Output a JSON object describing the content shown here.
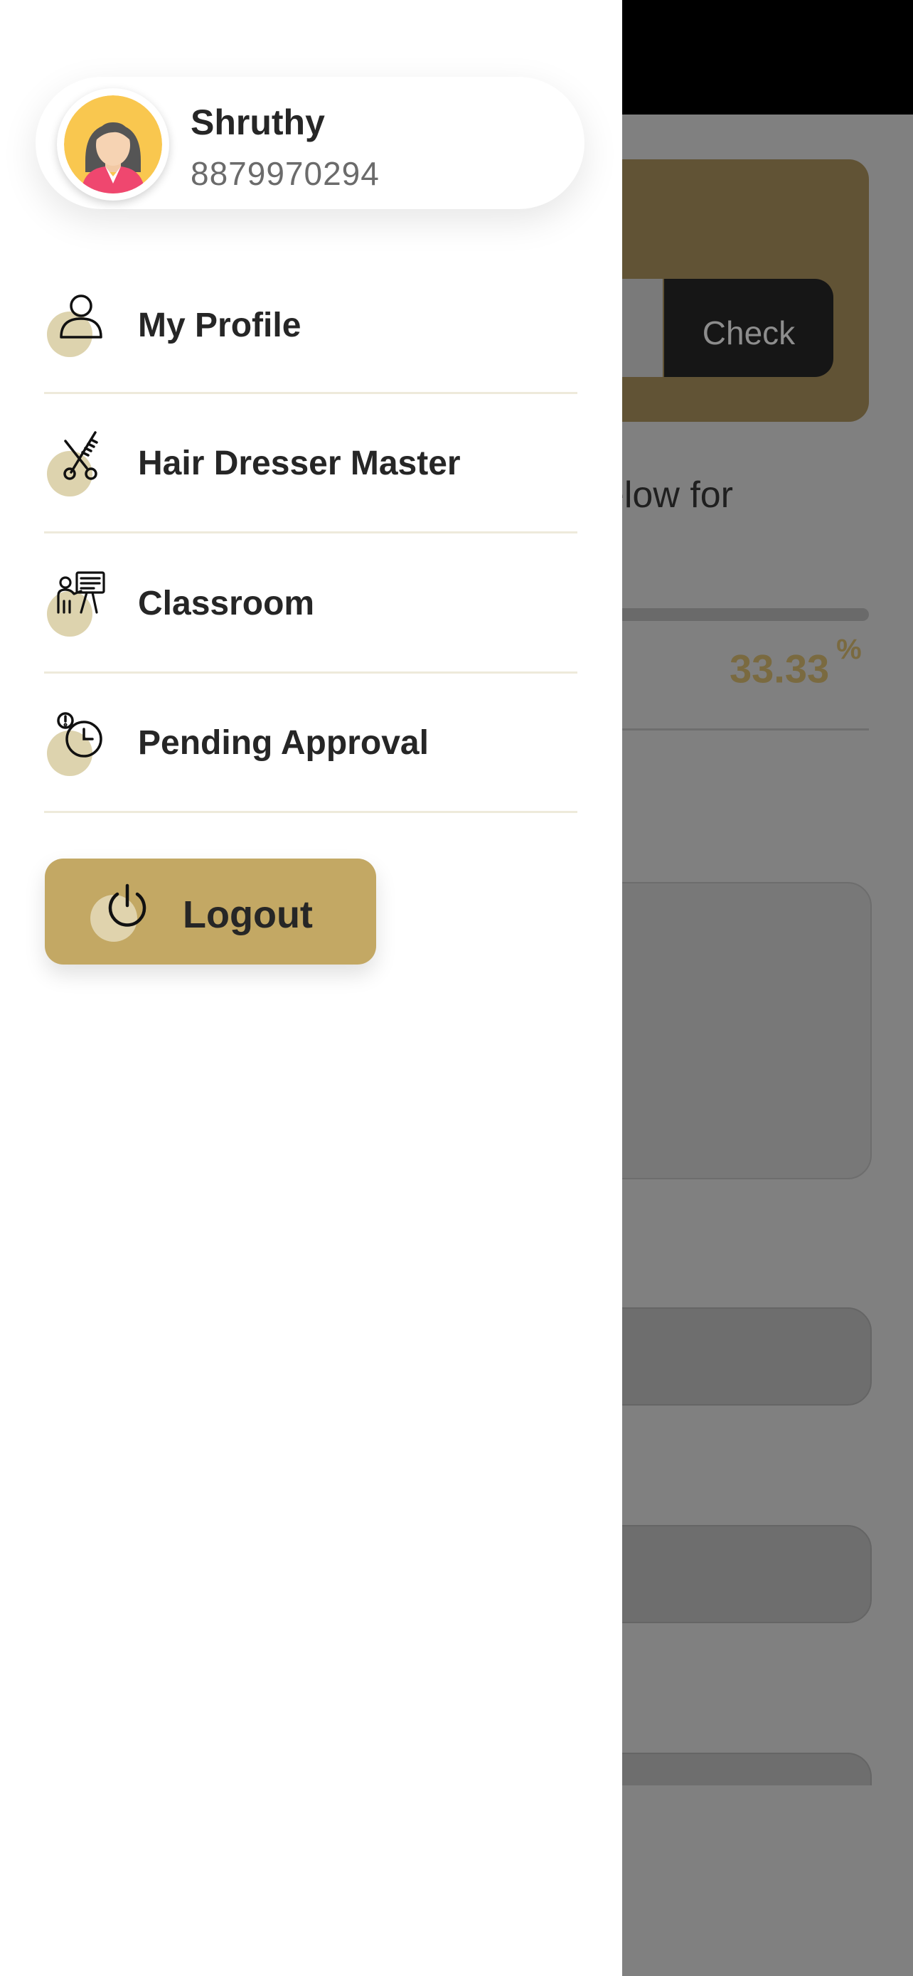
{
  "user": {
    "name": "Shruthy",
    "phone": "8879970294",
    "avatar_icon": "woman-avatar-icon"
  },
  "menu": {
    "items": [
      {
        "label": "My Profile",
        "icon": "person-icon"
      },
      {
        "label": "Hair Dresser Master",
        "icon": "scissors-comb-icon"
      },
      {
        "label": "Classroom",
        "icon": "teacher-board-icon"
      },
      {
        "label": "Pending Approval",
        "icon": "clock-alert-icon"
      }
    ],
    "logout_label": "Logout",
    "logout_icon": "power-icon"
  },
  "background": {
    "check_label": "Check",
    "text_fragment": "below for",
    "progress_percent": "33.33",
    "percent_sign": "%"
  },
  "colors": {
    "accent": "#c3a864",
    "icon_blob": "#ddd3ae",
    "overlay": "#808080",
    "separator": "#eeeadb"
  }
}
